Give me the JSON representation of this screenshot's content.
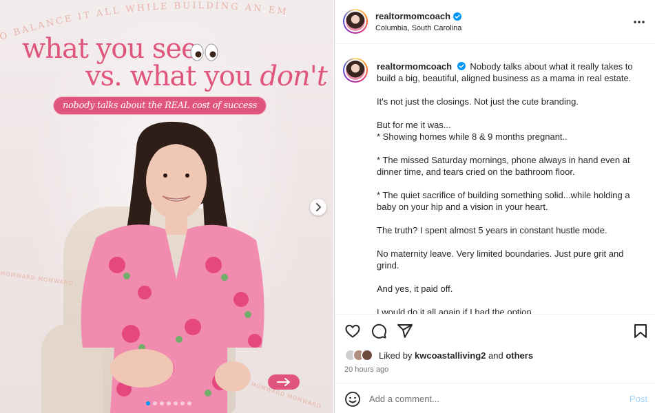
{
  "post": {
    "username": "realtormomcoach",
    "location": "Columbia, South Carolina",
    "verified": true
  },
  "media": {
    "arc_text": "TO BALANCE IT ALL WHILE BUILDING AN EMPIRE",
    "title_part1": "what you see",
    "title_part2_plain": "vs. what you ",
    "title_part2_accent": "don't",
    "subtitle": "nobody talks about the REAL cost of success",
    "brand_stamp": "MOMWARD MOMWARD",
    "carousel_dots": 7,
    "active_dot": 1,
    "colors": {
      "accent_pink": "#e0557f"
    }
  },
  "caption": {
    "username": "realtormomcoach",
    "intro": "Nobody talks about what it really takes to build a big, beautiful, aligned business as a mama in real estate.",
    "paragraphs": [
      "It's not just the closings. Not just the cute branding.",
      "But for me it was...\n* Showing homes while 8 & 9 months pregnant..",
      "* The missed Saturday mornings, phone always in hand even at dinner time, and tears cried on the bathroom floor.",
      "* The quiet sacrifice of building something solid...while holding a baby on your hip and a vision in your heart.",
      "The truth? I spent almost 5 years in constant hustle mode.",
      "No maternity leave. Very limited boundaries. Just pure grit and grind.",
      "And yes, it paid off.",
      "I would do it all again if I had the option."
    ]
  },
  "likes": {
    "prefix": "Liked by",
    "user": "kwcoastalliving2",
    "joiner": "and",
    "others": "others"
  },
  "timestamp": "20 hours ago",
  "comment": {
    "placeholder": "Add a comment...",
    "post_label": "Post"
  },
  "icons": [
    "more-icon",
    "heart-icon",
    "comment-icon",
    "share-icon",
    "bookmark-icon",
    "emoji-icon",
    "verified-icon",
    "chevron-right-icon",
    "arrow-right-icon"
  ],
  "colors": {
    "link_blue": "#0095f6",
    "post_disabled": "#9fd3fb",
    "muted": "#737373"
  }
}
